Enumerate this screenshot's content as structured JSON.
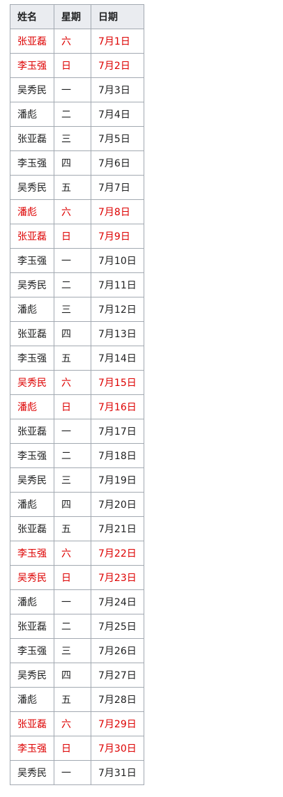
{
  "table": {
    "headers": [
      "姓名",
      "星期",
      "日期"
    ],
    "weekend_color": "#dd0000",
    "rows": [
      {
        "name": "张亚磊",
        "weekday": "六",
        "date": "7月1日",
        "weekend": true
      },
      {
        "name": "李玉强",
        "weekday": "日",
        "date": "7月2日",
        "weekend": true
      },
      {
        "name": "吴秀民",
        "weekday": "一",
        "date": "7月3日",
        "weekend": false
      },
      {
        "name": "潘彪",
        "weekday": "二",
        "date": "7月4日",
        "weekend": false
      },
      {
        "name": "张亚磊",
        "weekday": "三",
        "date": "7月5日",
        "weekend": false
      },
      {
        "name": "李玉强",
        "weekday": "四",
        "date": "7月6日",
        "weekend": false
      },
      {
        "name": "吴秀民",
        "weekday": "五",
        "date": "7月7日",
        "weekend": false
      },
      {
        "name": "潘彪",
        "weekday": "六",
        "date": "7月8日",
        "weekend": true
      },
      {
        "name": "张亚磊",
        "weekday": "日",
        "date": "7月9日",
        "weekend": true
      },
      {
        "name": "李玉强",
        "weekday": "一",
        "date": "7月10日",
        "weekend": false
      },
      {
        "name": "吴秀民",
        "weekday": "二",
        "date": "7月11日",
        "weekend": false
      },
      {
        "name": "潘彪",
        "weekday": "三",
        "date": "7月12日",
        "weekend": false
      },
      {
        "name": "张亚磊",
        "weekday": "四",
        "date": "7月13日",
        "weekend": false
      },
      {
        "name": "李玉强",
        "weekday": "五",
        "date": "7月14日",
        "weekend": false
      },
      {
        "name": "吴秀民",
        "weekday": "六",
        "date": "7月15日",
        "weekend": true
      },
      {
        "name": "潘彪",
        "weekday": "日",
        "date": "7月16日",
        "weekend": true
      },
      {
        "name": "张亚磊",
        "weekday": "一",
        "date": "7月17日",
        "weekend": false
      },
      {
        "name": "李玉强",
        "weekday": "二",
        "date": "7月18日",
        "weekend": false
      },
      {
        "name": "吴秀民",
        "weekday": "三",
        "date": "7月19日",
        "weekend": false
      },
      {
        "name": "潘彪",
        "weekday": "四",
        "date": "7月20日",
        "weekend": false
      },
      {
        "name": "张亚磊",
        "weekday": "五",
        "date": "7月21日",
        "weekend": false
      },
      {
        "name": "李玉强",
        "weekday": "六",
        "date": "7月22日",
        "weekend": true
      },
      {
        "name": "吴秀民",
        "weekday": "日",
        "date": "7月23日",
        "weekend": true
      },
      {
        "name": "潘彪",
        "weekday": "一",
        "date": "7月24日",
        "weekend": false
      },
      {
        "name": "张亚磊",
        "weekday": "二",
        "date": "7月25日",
        "weekend": false
      },
      {
        "name": "李玉强",
        "weekday": "三",
        "date": "7月26日",
        "weekend": false
      },
      {
        "name": "吴秀民",
        "weekday": "四",
        "date": "7月27日",
        "weekend": false
      },
      {
        "name": "潘彪",
        "weekday": "五",
        "date": "7月28日",
        "weekend": false
      },
      {
        "name": "张亚磊",
        "weekday": "六",
        "date": "7月29日",
        "weekend": true
      },
      {
        "name": "李玉强",
        "weekday": "日",
        "date": "7月30日",
        "weekend": true
      },
      {
        "name": "吴秀民",
        "weekday": "一",
        "date": "7月31日",
        "weekend": false
      }
    ]
  }
}
